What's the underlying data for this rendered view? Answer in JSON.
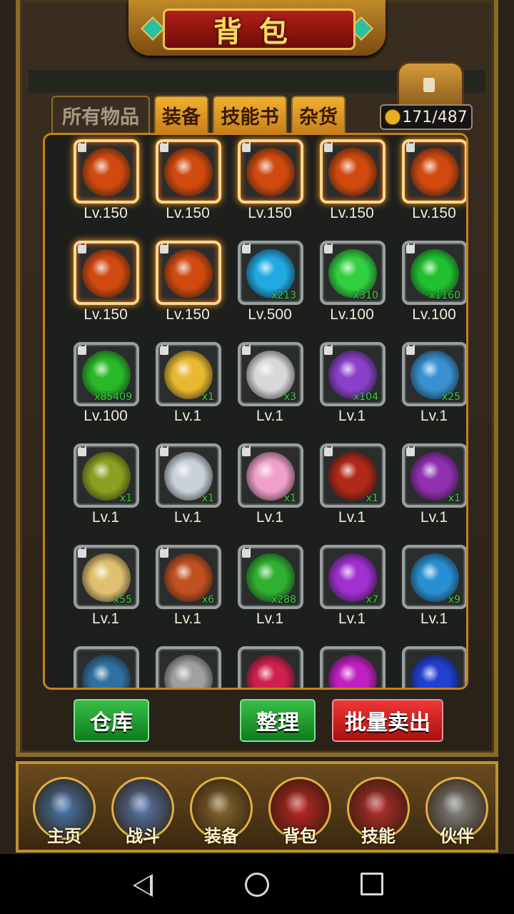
{
  "title": "背包",
  "tabs": [
    {
      "label": "所有物品",
      "active": false
    },
    {
      "label": "装备",
      "active": true
    },
    {
      "label": "技能书",
      "active": true
    },
    {
      "label": "杂货",
      "active": true
    }
  ],
  "capacity": "171/487",
  "items": [
    {
      "icon": "golden-armor-icon",
      "level": "Lv.150",
      "qty": "",
      "locked": true,
      "color": "#d04a10",
      "glow": true
    },
    {
      "icon": "golden-armor-icon",
      "level": "Lv.150",
      "qty": "",
      "locked": true,
      "color": "#d04a10",
      "glow": true
    },
    {
      "icon": "golden-armor-icon",
      "level": "Lv.150",
      "qty": "",
      "locked": true,
      "color": "#d04a10",
      "glow": true
    },
    {
      "icon": "golden-armor-icon",
      "level": "Lv.150",
      "qty": "",
      "locked": true,
      "color": "#d04a10",
      "glow": true
    },
    {
      "icon": "golden-armor-icon",
      "level": "Lv.150",
      "qty": "",
      "locked": true,
      "color": "#d04a10",
      "glow": true
    },
    {
      "icon": "golden-armor-icon",
      "level": "Lv.150",
      "qty": "",
      "locked": true,
      "color": "#d04a10",
      "glow": true
    },
    {
      "icon": "golden-armor-icon",
      "level": "Lv.150",
      "qty": "",
      "locked": true,
      "color": "#d04a10",
      "glow": true
    },
    {
      "icon": "blue-gem-icon",
      "level": "Lv.500",
      "qty": "x213",
      "locked": true,
      "color": "#20a8e0",
      "glow": false
    },
    {
      "icon": "green-gem-icon",
      "level": "Lv.100",
      "qty": "x310",
      "locked": true,
      "color": "#30d040",
      "glow": false
    },
    {
      "icon": "green-emerald-icon",
      "level": "Lv.100",
      "qty": "x1160",
      "locked": true,
      "color": "#20c030",
      "glow": false
    },
    {
      "icon": "green-crystal-icon",
      "level": "Lv.100",
      "qty": "x85409",
      "locked": true,
      "color": "#28b828",
      "glow": false
    },
    {
      "icon": "rename-card-icon",
      "level": "Lv.1",
      "qty": "x1",
      "locked": true,
      "color": "#e8b830",
      "glow": false
    },
    {
      "icon": "yin-yang-icon",
      "level": "Lv.1",
      "qty": "x3",
      "locked": true,
      "color": "#d8d8d8",
      "glow": false
    },
    {
      "icon": "purple-ore-icon",
      "level": "Lv.1",
      "qty": "x104",
      "locked": true,
      "color": "#8a40c8",
      "glow": false
    },
    {
      "icon": "blue-ore-icon",
      "level": "Lv.1",
      "qty": "x25",
      "locked": true,
      "color": "#3890d0",
      "glow": false
    },
    {
      "icon": "herb-icon",
      "level": "Lv.1",
      "qty": "x1",
      "locked": true,
      "color": "#8aa020",
      "glow": false
    },
    {
      "icon": "tea-cup-icon",
      "level": "Lv.1",
      "qty": "x1",
      "locked": true,
      "color": "#c8d0d8",
      "glow": false
    },
    {
      "icon": "lotus-icon",
      "level": "Lv.1",
      "qty": "x1",
      "locked": true,
      "color": "#f0a0c8",
      "glow": false
    },
    {
      "icon": "warrior-portrait-icon",
      "level": "Lv.1",
      "qty": "x1",
      "locked": true,
      "color": "#b02818",
      "glow": false
    },
    {
      "icon": "sword-icon",
      "level": "Lv.1",
      "qty": "x1",
      "locked": true,
      "color": "#9030b0",
      "glow": false
    },
    {
      "icon": "rainbow-orb-icon",
      "level": "Lv.1",
      "qty": "x55",
      "locked": true,
      "color": "#e0c070",
      "glow": false
    },
    {
      "icon": "beads-icon",
      "level": "Lv.1",
      "qty": "x6",
      "locked": true,
      "color": "#c05020",
      "glow": false
    },
    {
      "icon": "green-flame-icon",
      "level": "Lv.1",
      "qty": "x288",
      "locked": true,
      "color": "#30b030",
      "glow": false
    },
    {
      "icon": "purple-orb-icon",
      "level": "Lv.1",
      "qty": "x7",
      "locked": false,
      "color": "#a030d0",
      "glow": false
    },
    {
      "icon": "blue-orb-icon",
      "level": "Lv.1",
      "qty": "x9",
      "locked": false,
      "color": "#2890d0",
      "glow": false
    },
    {
      "icon": "blue-swirl-orb-icon",
      "level": "",
      "qty": "",
      "locked": false,
      "color": "#3070a0",
      "glow": false
    },
    {
      "icon": "fan-icon",
      "level": "",
      "qty": "",
      "locked": false,
      "color": "#a0a0a0",
      "glow": false
    },
    {
      "icon": "red-orb-icon",
      "level": "",
      "qty": "",
      "locked": false,
      "color": "#d02050",
      "glow": false
    },
    {
      "icon": "magenta-orb-icon",
      "level": "",
      "qty": "",
      "locked": false,
      "color": "#c020c0",
      "glow": false
    },
    {
      "icon": "deep-blue-orb-icon",
      "level": "",
      "qty": "",
      "locked": false,
      "color": "#2040d0",
      "glow": false
    }
  ],
  "buttons": {
    "warehouse": "仓库",
    "sort": "整理",
    "bulk_sell": "批量卖出"
  },
  "nav": [
    {
      "label": "主页",
      "icon": "home-icon",
      "color": "#4a7ab0"
    },
    {
      "label": "战斗",
      "icon": "battle-swords-icon",
      "color": "#5a7ab0"
    },
    {
      "label": "装备",
      "icon": "equipment-armor-icon",
      "color": "#8a6a30"
    },
    {
      "label": "背包",
      "icon": "backpack-bag-icon",
      "color": "#c02828"
    },
    {
      "label": "技能",
      "icon": "skills-chest-icon",
      "color": "#b83030"
    },
    {
      "label": "伙伴",
      "icon": "partner-helmet-icon",
      "color": "#8a8a8a"
    }
  ]
}
